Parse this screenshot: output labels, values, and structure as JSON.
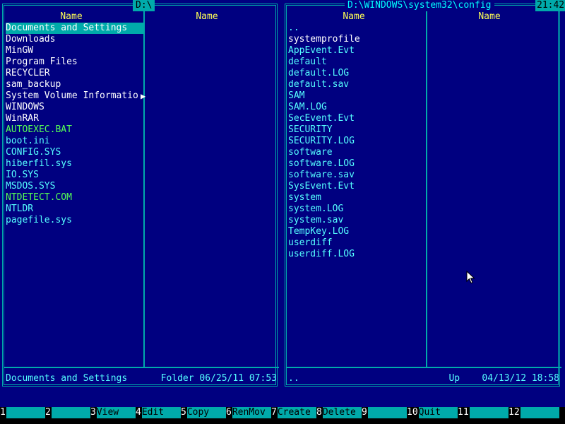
{
  "clock": "21:42",
  "left_panel": {
    "path": "D:\\",
    "column_header": "Name",
    "files": [
      {
        "name": "Documents and Settings",
        "kind": "dir",
        "selected": true
      },
      {
        "name": "Downloads",
        "kind": "dir"
      },
      {
        "name": "MinGW",
        "kind": "dir"
      },
      {
        "name": "Program Files",
        "kind": "dir"
      },
      {
        "name": "RECYCLER",
        "kind": "dir"
      },
      {
        "name": "sam_backup",
        "kind": "dir"
      },
      {
        "name": "System Volume Informatio",
        "kind": "dir"
      },
      {
        "name": "WINDOWS",
        "kind": "dir"
      },
      {
        "name": "WinRAR",
        "kind": "dir"
      },
      {
        "name": "AUTOEXEC.BAT",
        "kind": "exe"
      },
      {
        "name": "boot.ini",
        "kind": "file"
      },
      {
        "name": "CONFIG.SYS",
        "kind": "file"
      },
      {
        "name": "hiberfil.sys",
        "kind": "file"
      },
      {
        "name": "IO.SYS",
        "kind": "file"
      },
      {
        "name": "MSDOS.SYS",
        "kind": "file"
      },
      {
        "name": "NTDETECT.COM",
        "kind": "exe"
      },
      {
        "name": "NTLDR",
        "kind": "file"
      },
      {
        "name": "pagefile.sys",
        "kind": "file"
      }
    ],
    "status": {
      "name": "Documents and Settings",
      "info": "Folder 06/25/11 07:53"
    }
  },
  "right_panel": {
    "path": "D:\\WINDOWS\\system32\\config",
    "column_header": "Name",
    "files": [
      {
        "name": "..",
        "kind": "file"
      },
      {
        "name": "systemprofile",
        "kind": "dir"
      },
      {
        "name": "AppEvent.Evt",
        "kind": "file"
      },
      {
        "name": "default",
        "kind": "file"
      },
      {
        "name": "default.LOG",
        "kind": "file"
      },
      {
        "name": "default.sav",
        "kind": "file"
      },
      {
        "name": "SAM",
        "kind": "file"
      },
      {
        "name": "SAM.LOG",
        "kind": "file"
      },
      {
        "name": "SecEvent.Evt",
        "kind": "file"
      },
      {
        "name": "SECURITY",
        "kind": "file"
      },
      {
        "name": "SECURITY.LOG",
        "kind": "file"
      },
      {
        "name": "software",
        "kind": "file"
      },
      {
        "name": "software.LOG",
        "kind": "file"
      },
      {
        "name": "software.sav",
        "kind": "file"
      },
      {
        "name": "SysEvent.Evt",
        "kind": "file"
      },
      {
        "name": "system",
        "kind": "file"
      },
      {
        "name": "system.LOG",
        "kind": "file"
      },
      {
        "name": "system.sav",
        "kind": "file"
      },
      {
        "name": "TempKey.LOG",
        "kind": "file"
      },
      {
        "name": "userdiff",
        "kind": "file"
      },
      {
        "name": "userdiff.LOG",
        "kind": "file"
      }
    ],
    "status": {
      "name": "..",
      "info": "Up    04/13/12 18:58"
    }
  },
  "function_keys": [
    {
      "num": "1",
      "label": ""
    },
    {
      "num": "2",
      "label": ""
    },
    {
      "num": "3",
      "label": "View"
    },
    {
      "num": "4",
      "label": "Edit"
    },
    {
      "num": "5",
      "label": "Copy"
    },
    {
      "num": "6",
      "label": "RenMov"
    },
    {
      "num": "7",
      "label": "Create"
    },
    {
      "num": "8",
      "label": "Delete"
    },
    {
      "num": "9",
      "label": ""
    },
    {
      "num": "10",
      "label": "Quit"
    },
    {
      "num": "11",
      "label": ""
    },
    {
      "num": "12",
      "label": ""
    }
  ],
  "colors": {
    "background": "#000080",
    "frame": "#00AAAA",
    "header": "#FFFF55",
    "directory": "#FFFFFF",
    "file": "#55FFFF",
    "executable": "#55FF55"
  }
}
